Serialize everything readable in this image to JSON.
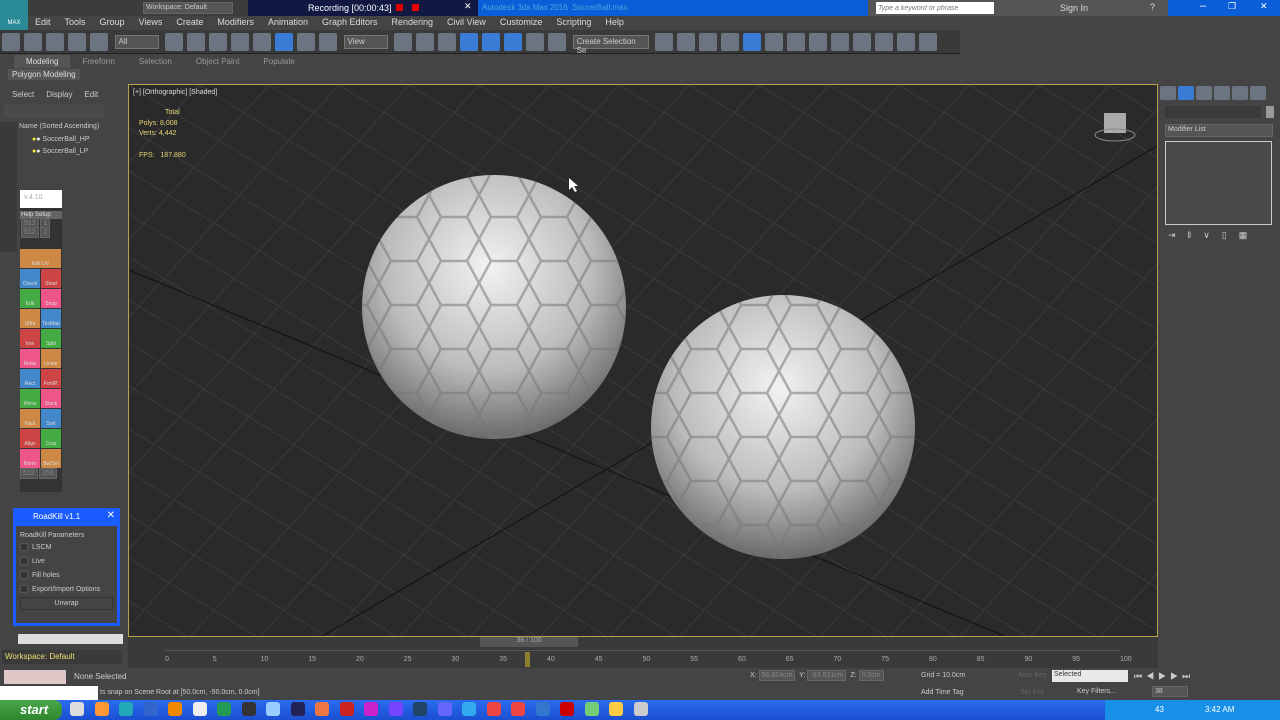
{
  "titlebar": {
    "logo": "MAX",
    "workspace": "Workspace: Default",
    "recording": "Recording [00:00:43]",
    "app_title": "Autodesk 3ds Max 2016",
    "file": "SoccerBall.max",
    "search_placeholder": "Type a keyword or phrase",
    "sign_in": "Sign In"
  },
  "menu": [
    "Edit",
    "Tools",
    "Group",
    "Views",
    "Create",
    "Modifiers",
    "Animation",
    "Graph Editors",
    "Rendering",
    "Civil View",
    "Customize",
    "Scripting",
    "Help"
  ],
  "toolbar": {
    "filter": "All",
    "ref_coord": "View",
    "selection_set": "Create Selection Se"
  },
  "ribbon": {
    "tabs": [
      "Modeling",
      "Freeform",
      "Selection",
      "Object Paint",
      "Populate"
    ],
    "sub": "Polygon Modeling"
  },
  "scene_explorer": {
    "tabs": [
      "Select",
      "Display",
      "Edit"
    ],
    "header": "Name (Sorted Ascending)",
    "items": [
      "SoccerBall_HP",
      "SoccerBall_LP"
    ]
  },
  "textools": {
    "version": "v.4.10",
    "help": "Help",
    "setup": "Setup",
    "size1": "512",
    "size2": "512",
    "v1": "1",
    "v2": "2",
    "labels": [
      "Edit UV",
      "Check",
      "Shad",
      "Edit",
      "Snap",
      "Ultra",
      "TexMap",
      "Iron",
      "Split",
      "Relax",
      "Linear",
      "Rect",
      "Fort/P.",
      "Mirror",
      "Stack",
      "Pack",
      "Sort",
      "Align",
      "Crop",
      "Norm",
      "Bw/Sel"
    ],
    "px": "512",
    "per": "256"
  },
  "roadkill": {
    "title": "RoadKill v1.1",
    "group": "RoadKill Parameters",
    "options": [
      "LSCM",
      "Live",
      "Fill holes",
      "Export/Import Options"
    ],
    "button": "Unwrap"
  },
  "viewport": {
    "label": "[+] [Orthographic] [Shaded]",
    "stats": {
      "total": "Total",
      "polys_label": "Polys:",
      "polys": "8,008",
      "verts_label": "Verts:",
      "verts": "4,442",
      "fps_label": "FPS:",
      "fps": "187.880"
    }
  },
  "cmdpanel": {
    "modifier_list": "Modifier List"
  },
  "timeline": {
    "frame": "38 / 100",
    "current": 38,
    "ticks": [
      "0",
      "5",
      "10",
      "15",
      "20",
      "25",
      "30",
      "35",
      "40",
      "45",
      "50",
      "55",
      "60",
      "65",
      "70",
      "75",
      "80",
      "85",
      "90",
      "95",
      "100"
    ]
  },
  "status": {
    "workspace": "Workspace: Default",
    "selection": "None Selected",
    "prompt": "ts snap on Scene Root at [50.0cm, -90.0cm, 0.0cm]",
    "x_label": "X:",
    "x": "56.824cm",
    "y_label": "Y:",
    "y": "-93.631cm",
    "z_label": "Z:",
    "z": "0.0cm",
    "grid": "Grid = 10.0cm",
    "add_time_tag": "Add Time Tag",
    "auto_key": "Auto Key",
    "set_key": "Set Key",
    "key_mode": "Selected",
    "key_filters": "Key Filters...",
    "frame_field": "38"
  },
  "taskbar": {
    "start": "start",
    "clock": "3:42 AM",
    "tray_num": "43"
  }
}
